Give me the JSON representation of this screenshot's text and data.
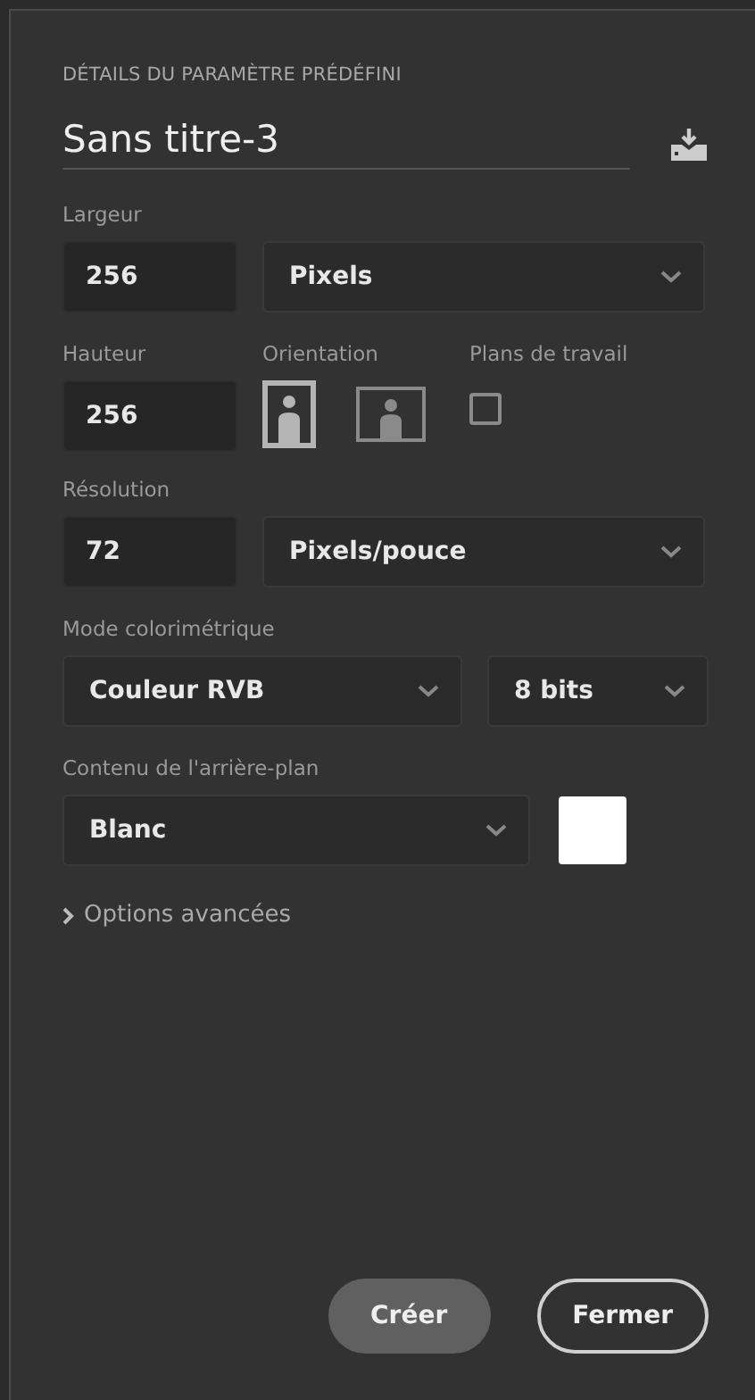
{
  "section_title": "DÉTAILS DU PARAMÈTRE PRÉDÉFINI",
  "preset_name": "Sans titre-3",
  "width": {
    "label": "Largeur",
    "value": "256",
    "unit": "Pixels"
  },
  "height": {
    "label": "Hauteur",
    "value": "256"
  },
  "orientation": {
    "label": "Orientation",
    "options": [
      {
        "kind": "portrait",
        "selected": true
      },
      {
        "kind": "landscape",
        "selected": false
      }
    ]
  },
  "artboards": {
    "label": "Plans de travail",
    "checked": false
  },
  "resolution": {
    "label": "Résolution",
    "value": "72",
    "unit": "Pixels/pouce"
  },
  "color_mode": {
    "label": "Mode colorimétrique",
    "mode": "Couleur RVB",
    "depth": "8 bits"
  },
  "background": {
    "label": "Contenu de l'arrière-plan",
    "value": "Blanc",
    "color": "#ffffff"
  },
  "advanced": {
    "label": "Options avancées",
    "expanded": false
  },
  "buttons": [
    {
      "label": "Créer",
      "kind": "primary"
    },
    {
      "label": "Fermer",
      "kind": "secondary"
    }
  ]
}
